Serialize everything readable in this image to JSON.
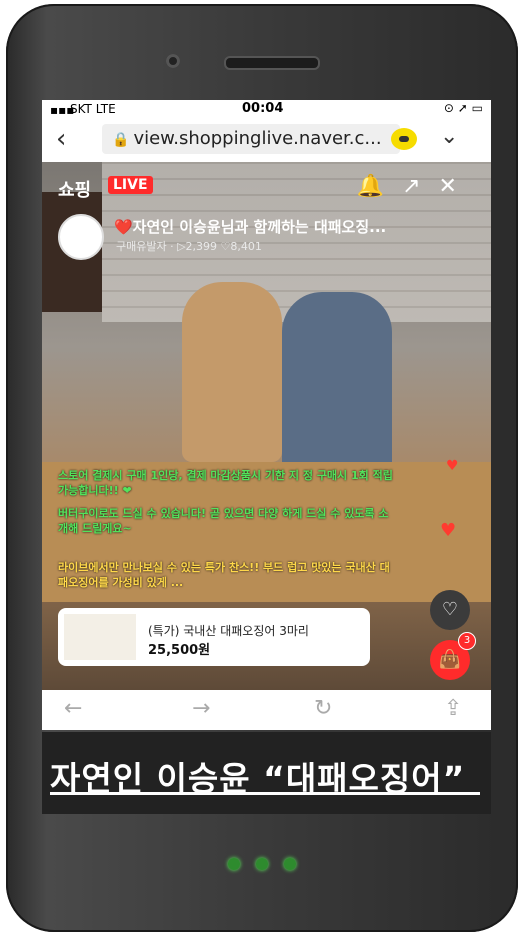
{
  "status": {
    "carrier": "SKT  LTE",
    "time": "00:04"
  },
  "browser": {
    "url": "view.shoppinglive.naver.c..."
  },
  "live": {
    "brand": "쇼핑",
    "badge": "LIVE",
    "title": "❤️자연인 이승윤님과 함께하는 대패오징...",
    "meta": "구매유발자 · ▷2,399 ♡8,401"
  },
  "chat": [
    {
      "color": "green",
      "text": "스토어 결제시 구매 1인당, 결제 마감상품시 기한 지 정 구매시 1회 적립 가능합니다!! ❤"
    },
    {
      "color": "green",
      "text": "버터구이로도 드실 수 있습니다! 곧 있으면 다양 하게 드실 수 있도록 소개해 드릴게요~"
    },
    {
      "color": "yellow",
      "text": "라이브에서만 만나보실 수 있는 특가 찬스!! 부드 럽고 맛있는 국내산 대패오징어를 가성비 있게 ..."
    }
  ],
  "product": {
    "name": "(특가) 국내산 대패오징어 3마리",
    "price": "25,500원"
  },
  "cart_count": "3",
  "caption": "자연인 이승윤  “대패오징어”"
}
